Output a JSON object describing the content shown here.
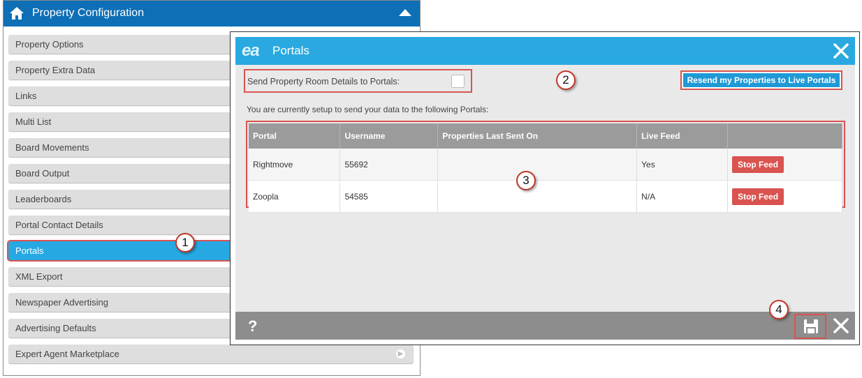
{
  "left_panel": {
    "title": "Property Configuration",
    "items": [
      {
        "label": "Property Options"
      },
      {
        "label": "Property Extra Data"
      },
      {
        "label": "Links"
      },
      {
        "label": "Multi List"
      },
      {
        "label": "Board Movements"
      },
      {
        "label": "Board Output"
      },
      {
        "label": "Leaderboards"
      },
      {
        "label": "Portal Contact Details"
      },
      {
        "label": "Portals",
        "active": true
      },
      {
        "label": "XML Export"
      },
      {
        "label": "Newspaper Advertising"
      },
      {
        "label": "Advertising Defaults"
      },
      {
        "label": "Expert Agent Marketplace"
      }
    ]
  },
  "modal": {
    "logo": "ea",
    "title": "Portals",
    "send_label": "Send Property Room Details to Portals:",
    "resend_label": "Resend my Properties to Live Portals",
    "intro": "You are currently setup to send your data to the following Portals:",
    "table": {
      "headers": [
        "Portal",
        "Username",
        "Properties Last Sent On",
        "Live Feed",
        ""
      ],
      "rows": [
        {
          "portal": "Rightmove",
          "username": "55692",
          "last_sent": "",
          "live_feed": "Yes",
          "action": "Stop Feed"
        },
        {
          "portal": "Zoopla",
          "username": "54585",
          "last_sent": "",
          "live_feed": "N/A",
          "action": "Stop Feed"
        }
      ]
    },
    "help": "?"
  },
  "callouts": [
    "1",
    "2",
    "3",
    "4"
  ],
  "colors": {
    "header_blue": "#0e6fb6",
    "modal_blue": "#29a9e0",
    "active_item": "#26a8e3",
    "highlight_red": "#d9534f"
  }
}
